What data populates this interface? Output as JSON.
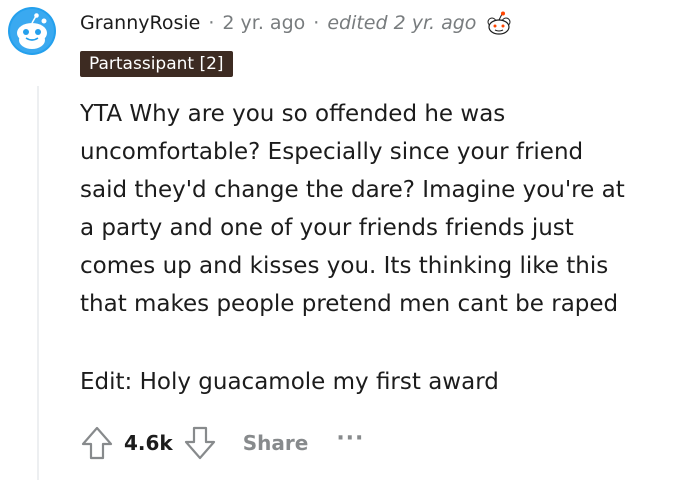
{
  "comment": {
    "username": "GrannyRosie",
    "separator": "·",
    "age": "2 yr. ago",
    "edited": "edited 2 yr. ago",
    "flair": "Partassipant [2]",
    "body_lines": [
      "YTA Why are you so offended he was",
      "uncomfortable? Especially since your friend",
      "said they'd change the dare? Imagine you're at",
      "a party and one of your friends friends just",
      "comes up and kisses you. Its thinking like this",
      "that makes people pretend men cant be raped"
    ],
    "edit_note": "Edit: Holy guacamole my first award",
    "score": "4.6k",
    "share_label": "Share",
    "more_label": "···"
  },
  "icons": {
    "avatar": "snoo-avatar-icon",
    "award": "award-icon",
    "upvote": "upvote-arrow-icon",
    "downvote": "downvote-arrow-icon"
  },
  "colors": {
    "flair_bg": "#3d2b22",
    "meta_text": "#787c7e",
    "avatar_blue": "#0dd3bb"
  }
}
